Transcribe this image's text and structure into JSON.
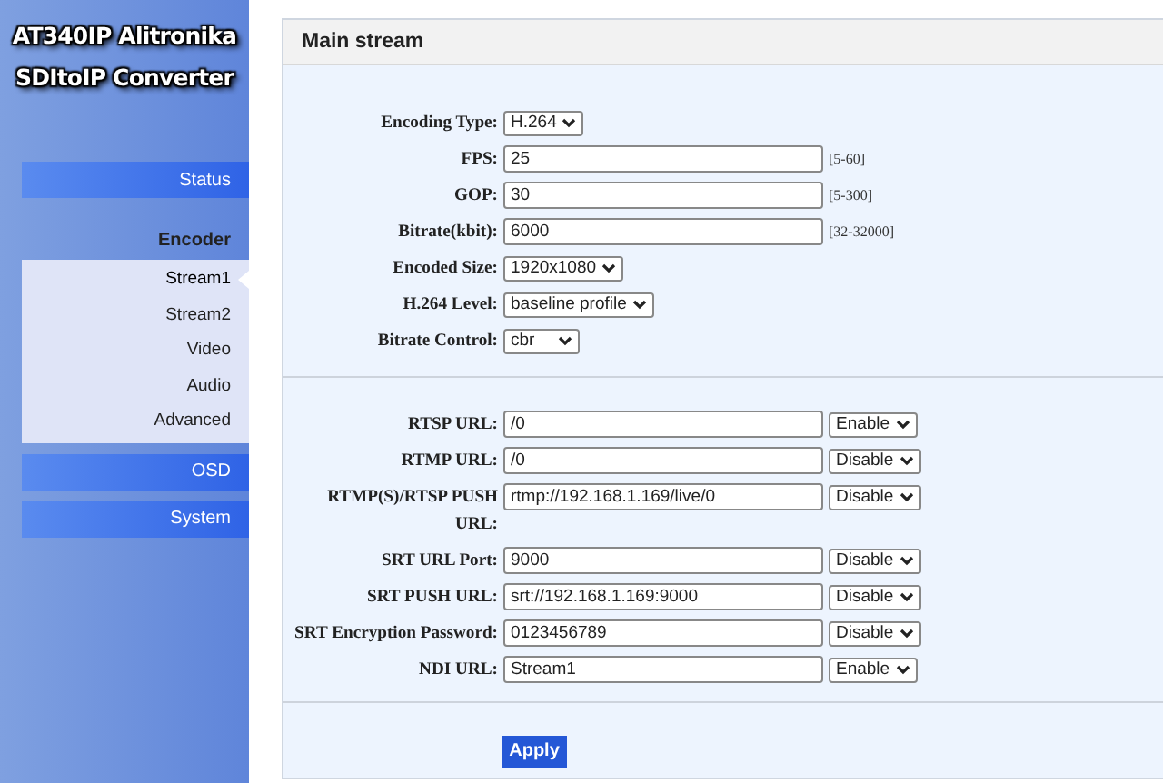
{
  "sidebar": {
    "title_lines": [
      "AT340IP Alitronika",
      "SDItoIP Converter"
    ],
    "items": [
      {
        "label": "Status",
        "kind": "button",
        "selected": false
      },
      {
        "label": "Encoder",
        "kind": "heading",
        "children": [
          {
            "label": "Stream1",
            "selected": true
          },
          {
            "label": "Stream2",
            "selected": false
          },
          {
            "label": "Video",
            "selected": false
          },
          {
            "label": "Audio",
            "selected": false
          },
          {
            "label": "Advanced",
            "selected": false
          }
        ]
      },
      {
        "label": "OSD",
        "kind": "button",
        "selected": false
      },
      {
        "label": "System",
        "kind": "button",
        "selected": false
      }
    ]
  },
  "panel": {
    "title": "Main stream",
    "encoding": [
      {
        "label": "Encoding Type:",
        "kind": "select",
        "value": "H.264"
      },
      {
        "label": "FPS:",
        "kind": "text",
        "value": "25",
        "range": "[5-60]"
      },
      {
        "label": "GOP:",
        "kind": "text",
        "value": "30",
        "range": "[5-300]"
      },
      {
        "label": "Bitrate(kbit):",
        "kind": "text",
        "value": "6000",
        "range": "[32-32000]"
      },
      {
        "label": "Encoded Size:",
        "kind": "select",
        "value": "1920x1080"
      },
      {
        "label": "H.264 Level:",
        "kind": "select",
        "value": "baseline profile"
      },
      {
        "label": "Bitrate Control:",
        "kind": "select",
        "value": "cbr"
      }
    ],
    "urls": [
      {
        "label": "RTSP URL:",
        "value": "/0",
        "status": "Enable"
      },
      {
        "label": "RTMP URL:",
        "value": "/0",
        "status": "Disable"
      },
      {
        "label": "RTMP(S)/RTSP PUSH URL:",
        "value": "rtmp://192.168.1.169/live/0",
        "status": "Disable"
      },
      {
        "label": "SRT URL Port:",
        "value": "9000",
        "status": "Disable"
      },
      {
        "label": "SRT PUSH URL:",
        "value": "srt://192.168.1.169:9000",
        "status": "Disable"
      },
      {
        "label": "SRT Encryption Password:",
        "value": "0123456789",
        "status": "Disable"
      },
      {
        "label": "NDI URL:",
        "value": "Stream1",
        "status": "Enable"
      }
    ],
    "apply_button": "Apply"
  }
}
